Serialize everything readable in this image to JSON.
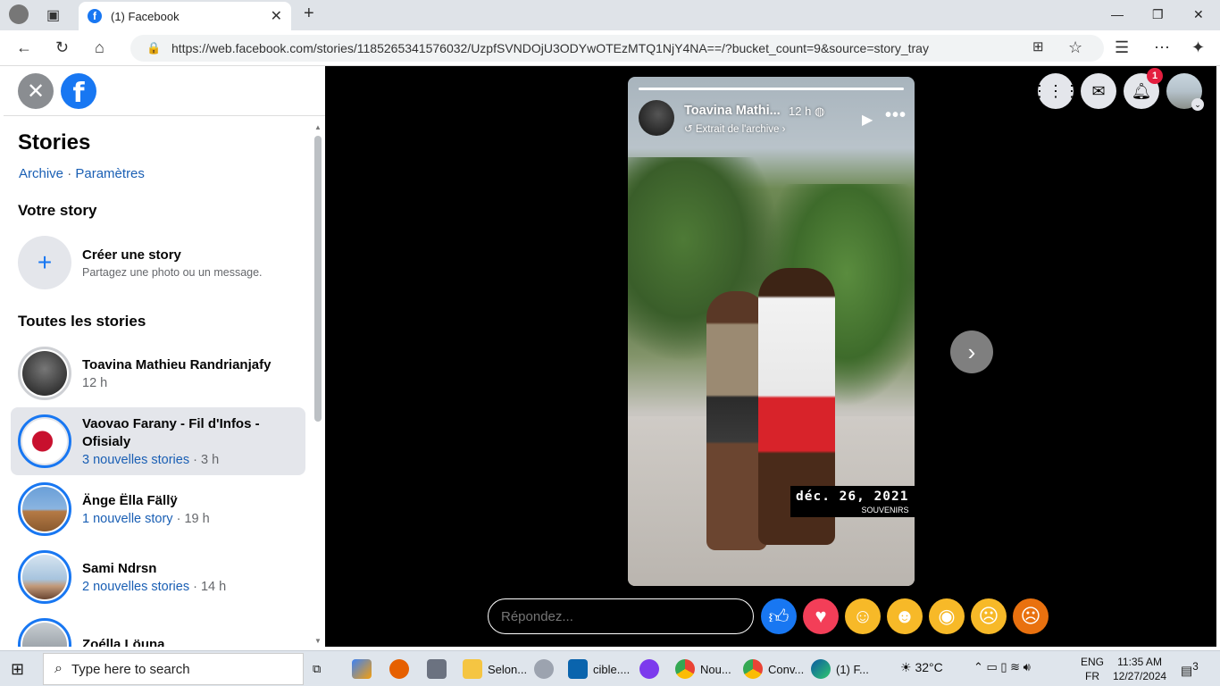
{
  "browser": {
    "tab_title": "(1) Facebook",
    "url": "https://web.facebook.com/stories/1185265341576032/UzpfSVNDOjU3ODYwOTEzMTQ1NjY4NA==/?bucket_count=9&source=story_tray"
  },
  "sidebar": {
    "title": "Stories",
    "link_archive": "Archive",
    "link_sep": " · ",
    "link_params": "Paramètres",
    "your_story_heading": "Votre story",
    "create_title": "Créer une story",
    "create_subtitle": "Partagez une photo ou un message.",
    "all_stories_heading": "Toutes les stories",
    "items": [
      {
        "name": "Toavina Mathieu Randrianjafy",
        "new_label": "",
        "time": "12 h",
        "seen": true
      },
      {
        "name": "Vaovao Farany - Fil d'Infos - Ofisialy",
        "new_label": "3 nouvelles stories",
        "time": " · 3 h",
        "seen": false
      },
      {
        "name": "Änge Ëlla Fällÿ",
        "new_label": "1 nouvelle story",
        "time": " · 19 h",
        "seen": false
      },
      {
        "name": "Sami Ndrsn",
        "new_label": "2 nouvelles stories",
        "time": " · 14 h",
        "seen": false
      },
      {
        "name": "Zoélla Löuna",
        "new_label": "",
        "time": "",
        "seen": false
      }
    ]
  },
  "story": {
    "author": "Toavina Mathi...",
    "time": "12 h",
    "archive_label": "Extrait de l'archive",
    "date_text": "déc. 26, 2021",
    "memory_label": "SOUVENIRS"
  },
  "top": {
    "notification_count": "1"
  },
  "reply": {
    "placeholder": "Répondez..."
  },
  "taskbar": {
    "search_placeholder": "Type here to search",
    "apps": [
      {
        "label": "Selon..."
      },
      {
        "label": "cible...."
      },
      {
        "label": "Nou..."
      },
      {
        "label": "Conv..."
      },
      {
        "label": "(1) F..."
      }
    ],
    "temperature": "32°C",
    "lang_top": "ENG",
    "lang_bottom": "FR",
    "time": "11:35 AM",
    "date": "12/27/2024",
    "notif_count": "3"
  },
  "colors": {
    "accent": "#1877f2",
    "link": "#1a5fb4",
    "badge": "#e41e3f"
  }
}
